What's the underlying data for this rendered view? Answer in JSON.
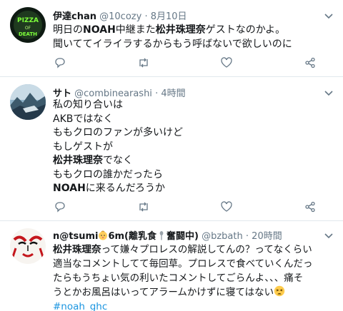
{
  "tweets": [
    {
      "name": "伊達chan",
      "handle": "@10cozy",
      "separator": "·",
      "time": "8月10日",
      "lines": [
        [
          "明日の",
          "NOAH",
          "中継また",
          "松井珠理奈",
          "ゲストなのかよ。"
        ],
        [
          "聞いててイライラするからもう呼ばないで欲しいのに"
        ]
      ]
    },
    {
      "name": "サト",
      "handle": "@combinearashi",
      "separator": "·",
      "time": "4時間",
      "lines": [
        [
          "私の知り合いは"
        ],
        [
          "AKBではなく"
        ],
        [
          "ももクロのファンが多いけど"
        ],
        [
          "もしゲストが"
        ],
        [
          "松井珠理奈",
          "でなく"
        ],
        [
          "ももクロの誰かだったら"
        ],
        [
          "NOAH",
          "に来るんだろうか"
        ]
      ]
    },
    {
      "name_part1": "n@tsumi",
      "name_part2": "6m(離乳食",
      "name_part3": "奮闘中)",
      "handle": "@bzbath",
      "separator": "·",
      "time": "20時間",
      "lines": [
        [
          "松井珠理奈",
          "って嫌々プロレスの解説してんの？ってなくらい"
        ],
        [
          "適当なコメントしてて毎回草。プロレスで食べていくんだっ"
        ],
        [
          "たらもうちょい気の利いたコメントしてごらんよ、、、痛そ"
        ],
        [
          "うとかお風呂はいってアラームかけずに寝てはない"
        ],
        [
          "#noah_ghc"
        ]
      ]
    }
  ],
  "icons": {
    "reply": "reply-icon",
    "retweet": "retweet-icon",
    "like": "heart-icon",
    "share": "share-icon",
    "caret": "chevron-down-icon"
  },
  "colors": {
    "text": "#14171a",
    "secondary": "#657786",
    "hashtag": "#1b95e0",
    "divider": "#e1e8ed"
  }
}
